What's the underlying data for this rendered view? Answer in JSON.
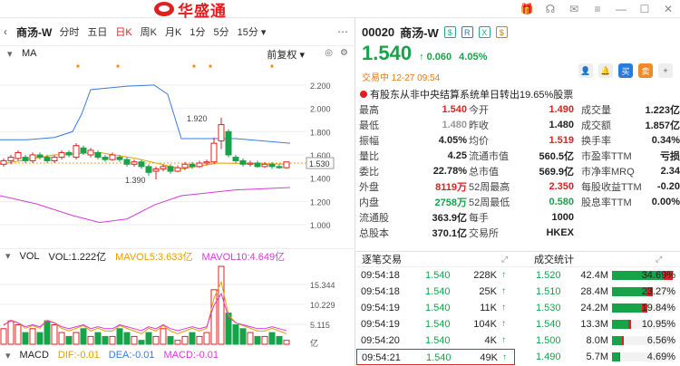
{
  "header": {
    "logo_text": "华盛通"
  },
  "toolbar": {
    "stock_name": "商汤-W",
    "items": [
      "分时",
      "五日",
      "日K",
      "周K",
      "月K",
      "1分",
      "5分"
    ],
    "active": "日K",
    "interval_dropdown": "15分"
  },
  "chart_header": {
    "ma_label": "MA",
    "adjust": "前复权"
  },
  "kline_axis": {
    "ticks": [
      "2.200",
      "2.000",
      "1.800",
      "1.600",
      "1.400",
      "1.200",
      "1.000"
    ],
    "current_price_label": "1.530",
    "high_label": "1.920",
    "low_label": "1.390"
  },
  "volume": {
    "label": "VOL",
    "vol": "VOL:1.222亿",
    "mavol5": "MAVOL5:3.633亿",
    "mavol10": "MAVOL10:4.649亿",
    "ticks": [
      "15.344",
      "10.229",
      "5.115",
      "亿"
    ]
  },
  "macd": {
    "label": "MACD",
    "dif": "DIF:-0.01",
    "dea": "DEA:-0.01",
    "macd": "MACD:-0.01"
  },
  "quote": {
    "code": "00020",
    "name": "商汤-W",
    "tags": [
      "$",
      "R",
      "X",
      "$"
    ],
    "price": "1.540",
    "change": "0.060",
    "change_pct": "4.05%",
    "status": "交易中 12-27 09:54",
    "buttons": [
      "👤",
      "🔔",
      "买",
      "卖",
      "+"
    ],
    "notice": "有股东从非中央结算系统单日转出19.65%股票"
  },
  "quote_rows": [
    [
      "最高",
      "1.540",
      "今开",
      "1.490",
      "成交量",
      "1.223亿"
    ],
    [
      "最低",
      "1.480",
      "昨收",
      "1.480",
      "成交额",
      "1.857亿"
    ],
    [
      "振幅",
      "4.05%",
      "均价",
      "1.519",
      "换手率",
      "0.34%"
    ],
    [
      "量比",
      "4.25",
      "流通市值",
      "560.5亿",
      "市盈率TTM",
      "亏损"
    ],
    [
      "委比",
      "22.78%",
      "总市值",
      "569.9亿",
      "市净率MRQ",
      "2.34"
    ],
    [
      "外盘",
      "8119万",
      "52周最高",
      "2.350",
      "每股收益TTM",
      "-0.20"
    ],
    [
      "内盘",
      "2758万",
      "52周最低",
      "0.580",
      "股息率TTM",
      "0.00%"
    ],
    [
      "流通股",
      "363.9亿",
      "每手",
      "1000",
      "",
      ""
    ],
    [
      "总股本",
      "370.1亿",
      "交易所",
      "HKEX",
      "",
      ""
    ]
  ],
  "panes": {
    "left": "逐笔交易",
    "right": "成交统计"
  },
  "trades": [
    [
      "09:54:18",
      "1.540",
      "228K"
    ],
    [
      "09:54:18",
      "1.540",
      "25K"
    ],
    [
      "09:54:19",
      "1.540",
      "11K"
    ],
    [
      "09:54:19",
      "1.540",
      "104K"
    ],
    [
      "09:54:20",
      "1.540",
      "4K"
    ],
    [
      "09:54:21",
      "1.540",
      "49K"
    ]
  ],
  "stats": [
    [
      "1.520",
      "42.4M",
      "34.69%",
      0.3469
    ],
    [
      "1.510",
      "28.4M",
      "23.27%",
      0.2327
    ],
    [
      "1.530",
      "24.2M",
      "19.84%",
      0.1984
    ],
    [
      "1.540",
      "13.3M",
      "10.95%",
      0.1095
    ],
    [
      "1.500",
      "8.0M",
      "6.56%",
      0.0656
    ],
    [
      "1.490",
      "5.7M",
      "4.69%",
      0.0469
    ]
  ]
}
